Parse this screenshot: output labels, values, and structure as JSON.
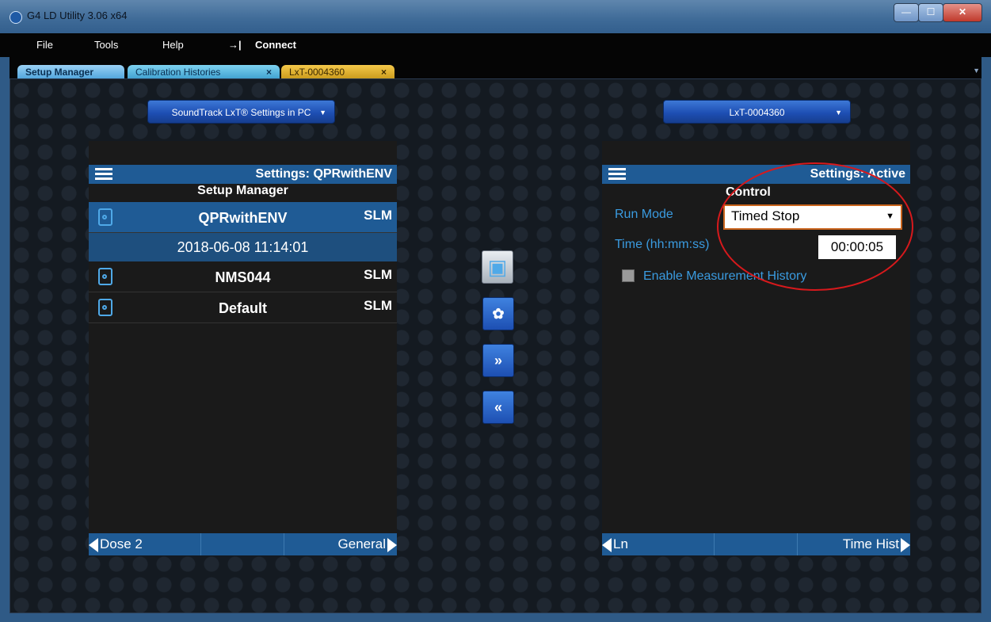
{
  "window": {
    "title": "G4 LD Utility 3.06 x64",
    "min": "—",
    "max": "☐",
    "close": "✕"
  },
  "menu": {
    "file": "File",
    "tools": "Tools",
    "help": "Help",
    "connect_icon": "→|",
    "connect": "Connect"
  },
  "tabs": [
    {
      "label": "Setup Manager"
    },
    {
      "label": "Calibration Histories",
      "close": "×"
    },
    {
      "label": "LxT-0004360",
      "close": "×"
    }
  ],
  "left": {
    "dropdown": "SoundTrack LxT® Settings in PC",
    "header_title": "Settings: QPRwithENV",
    "subtitle": "Setup Manager",
    "items": [
      {
        "name": "QPRwithENV",
        "type": "SLM"
      },
      {
        "name": "NMS044",
        "type": "SLM"
      },
      {
        "name": "Default",
        "type": "SLM"
      }
    ],
    "selected_date": "2018-06-08 11:14:01",
    "footer": {
      "prev": "Dose 2",
      "next": "General"
    }
  },
  "middle": {
    "forward": "»",
    "back": "«"
  },
  "right": {
    "dropdown": "LxT-0004360",
    "header_title": "Settings: Active",
    "section": "Control",
    "run_mode_label": "Run Mode",
    "run_mode_value": "Timed Stop",
    "time_label": "Time (hh:mm:ss)",
    "time_value": "00:00:05",
    "history_label": "Enable Measurement History",
    "footer": {
      "prev": "Ln",
      "next": "Time Hist"
    }
  },
  "colors": {
    "accent_blue": "#1f5b95",
    "label_blue": "#3a9be0",
    "annotation_red": "#d7191c",
    "select_border": "#c9641c"
  }
}
